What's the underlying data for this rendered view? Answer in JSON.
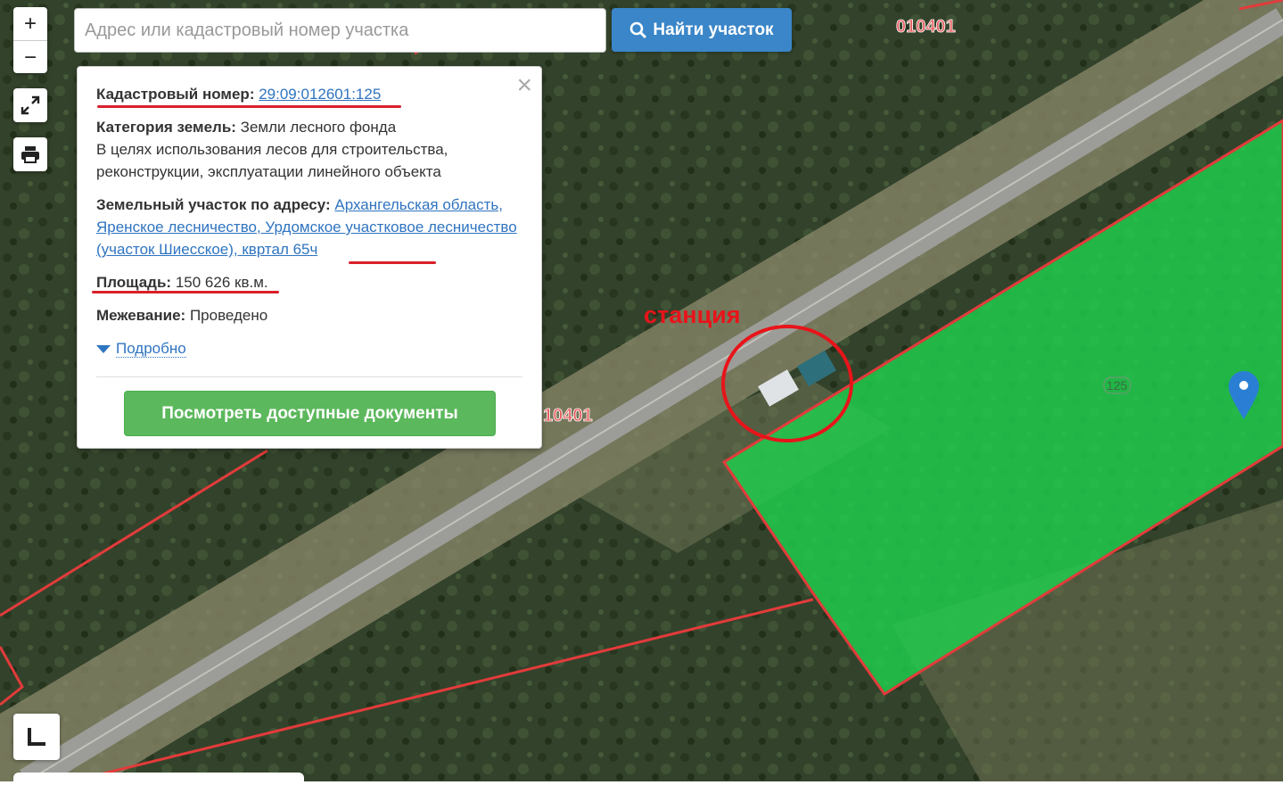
{
  "search": {
    "placeholder": "Адрес или кадастровый номер участка",
    "button_label": "Найти участок"
  },
  "controls": {
    "zoom_in": "+",
    "zoom_out": "−"
  },
  "popup": {
    "cadastral_label": "Кадастровый номер:",
    "cadastral_number": "29:09:012601:125",
    "category_label": "Категория земель:",
    "category_value": "Земли лесного фонда",
    "purpose": "В целях использования лесов для строительства, реконструкции, эксплуатации линейного объекта",
    "address_label": "Земельный участок по адресу:",
    "address_value": "Архангельская область, Яренское лесничество, Урдомское участковое лесничество (участок Шиесское), квртал 65ч",
    "area_label": "Площадь:",
    "area_value": "150 626 кв.м.",
    "survey_label": "Межевание:",
    "survey_value": "Проведено",
    "more_label": "Подробно",
    "docs_button": "Посмотреть доступные документы",
    "close_symbol": "×"
  },
  "map": {
    "annotation": "станция",
    "quarter_label_top": "010401",
    "quarter_label_mid": "10401",
    "parcel_label": "125",
    "colors": {
      "parcel_fill": "#1fd04e",
      "boundary": "#e23b3b",
      "annotation": "#e8141a",
      "marker": "#2a7fd4"
    }
  }
}
